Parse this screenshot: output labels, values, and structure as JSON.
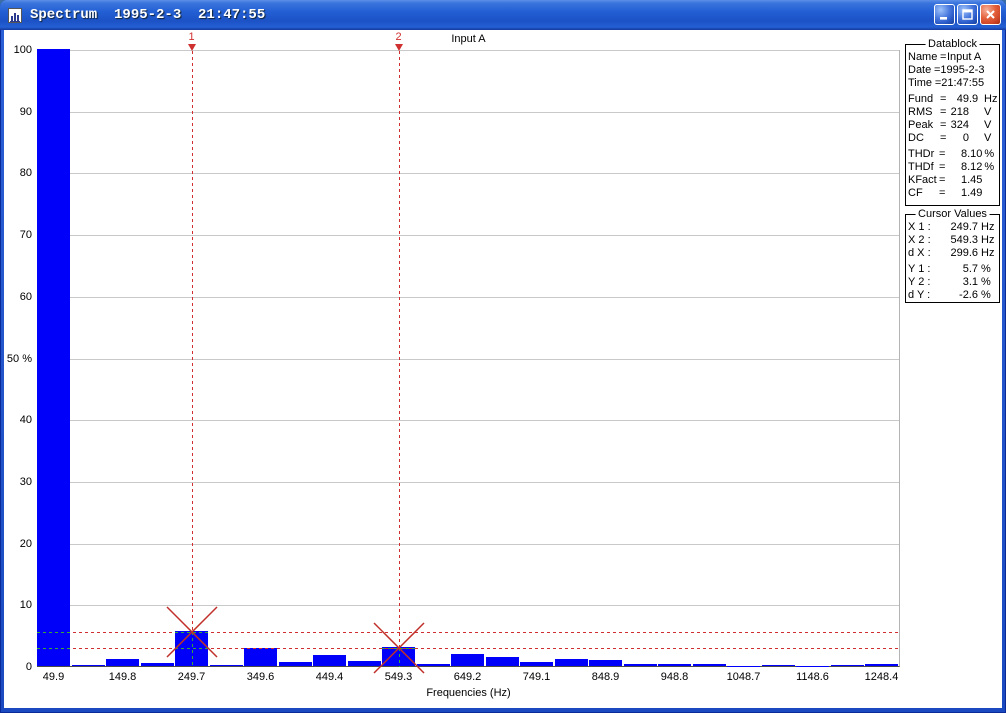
{
  "window": {
    "title": "Spectrum  1995-2-3  21:47:55",
    "controls": {
      "minimize": "minimize",
      "maximize": "maximize",
      "close": "close"
    }
  },
  "chart_data": {
    "type": "bar",
    "title": "Input A",
    "xlabel": "Frequencies (Hz)",
    "ylabel": "%",
    "ylim": [
      0,
      100
    ],
    "grid": "horizontal",
    "ytick_labels": [
      "0",
      "10",
      "20",
      "30",
      "40",
      "50 %",
      "60",
      "70",
      "80",
      "90",
      "100"
    ],
    "xtick_labels": [
      "49.9",
      "149.8",
      "249.7",
      "349.6",
      "449.4",
      "549.3",
      "649.2",
      "749.1",
      "848.9",
      "948.8",
      "1048.7",
      "1148.6",
      "1248.4"
    ],
    "x_hz": [
      49.9,
      99.9,
      149.8,
      199.7,
      249.7,
      299.6,
      349.6,
      399.5,
      449.4,
      499.4,
      549.3,
      599.2,
      649.2,
      699.1,
      749.1,
      799.0,
      848.9,
      898.9,
      948.8,
      998.7,
      1048.7,
      1098.6,
      1148.6,
      1198.5,
      1248.4
    ],
    "values_pct": [
      100,
      0.2,
      1.2,
      0.5,
      5.7,
      0.2,
      3.0,
      0.6,
      1.8,
      0.8,
      3.1,
      0.3,
      2.0,
      1.5,
      0.7,
      1.1,
      0.9,
      0.25,
      0.35,
      0.35,
      0.05,
      0.15,
      0.05,
      0.2,
      0.25
    ],
    "bar_color": "#0000fa",
    "cursor_line_color": "#cf2f2f",
    "cursor_mark_color": "#c03028",
    "cursor_highlight_color": "#35a835",
    "cursors": [
      {
        "label": "1",
        "bar_index": 4,
        "x_hz": "249.7",
        "y_pct": 5.7
      },
      {
        "label": "2",
        "bar_index": 10,
        "x_hz": "549.3",
        "y_pct": 3.1
      }
    ]
  },
  "datablock": {
    "title": "Datablock",
    "rows": [
      {
        "label": "Name",
        "value": "Input A",
        "unit": "",
        "text": true
      },
      {
        "label": "Date",
        "value": "1995-2-3",
        "unit": "",
        "text": true
      },
      {
        "label": "Time",
        "value": "21:47:55",
        "unit": "",
        "text": true
      },
      {
        "label": "Fund",
        "value": "49.9",
        "unit": "Hz",
        "gap": true
      },
      {
        "label": "RMS",
        "value": "218",
        "unit": "V"
      },
      {
        "label": "Peak",
        "value": "324",
        "unit": "V"
      },
      {
        "label": "DC",
        "value": "0",
        "unit": "V"
      },
      {
        "label": "THDr",
        "value": "8.10",
        "unit": "%",
        "gap": true
      },
      {
        "label": "THDf",
        "value": "8.12",
        "unit": "%"
      },
      {
        "label": "KFact",
        "value": "1.45",
        "unit": ""
      },
      {
        "label": "CF",
        "value": "1.49",
        "unit": ""
      }
    ]
  },
  "cursor_values": {
    "title": "Cursor Values",
    "rows": [
      {
        "label": "X 1 :",
        "value": "249.7",
        "unit": "Hz"
      },
      {
        "label": "X 2 :",
        "value": "549.3",
        "unit": "Hz"
      },
      {
        "label": "d X :",
        "value": "299.6",
        "unit": "Hz"
      },
      {
        "label": "Y 1 :",
        "value": "5.7",
        "unit": "%",
        "gap": true
      },
      {
        "label": "Y 2 :",
        "value": "3.1",
        "unit": "%"
      },
      {
        "label": "d Y :",
        "value": "-2.6",
        "unit": "%"
      }
    ]
  }
}
